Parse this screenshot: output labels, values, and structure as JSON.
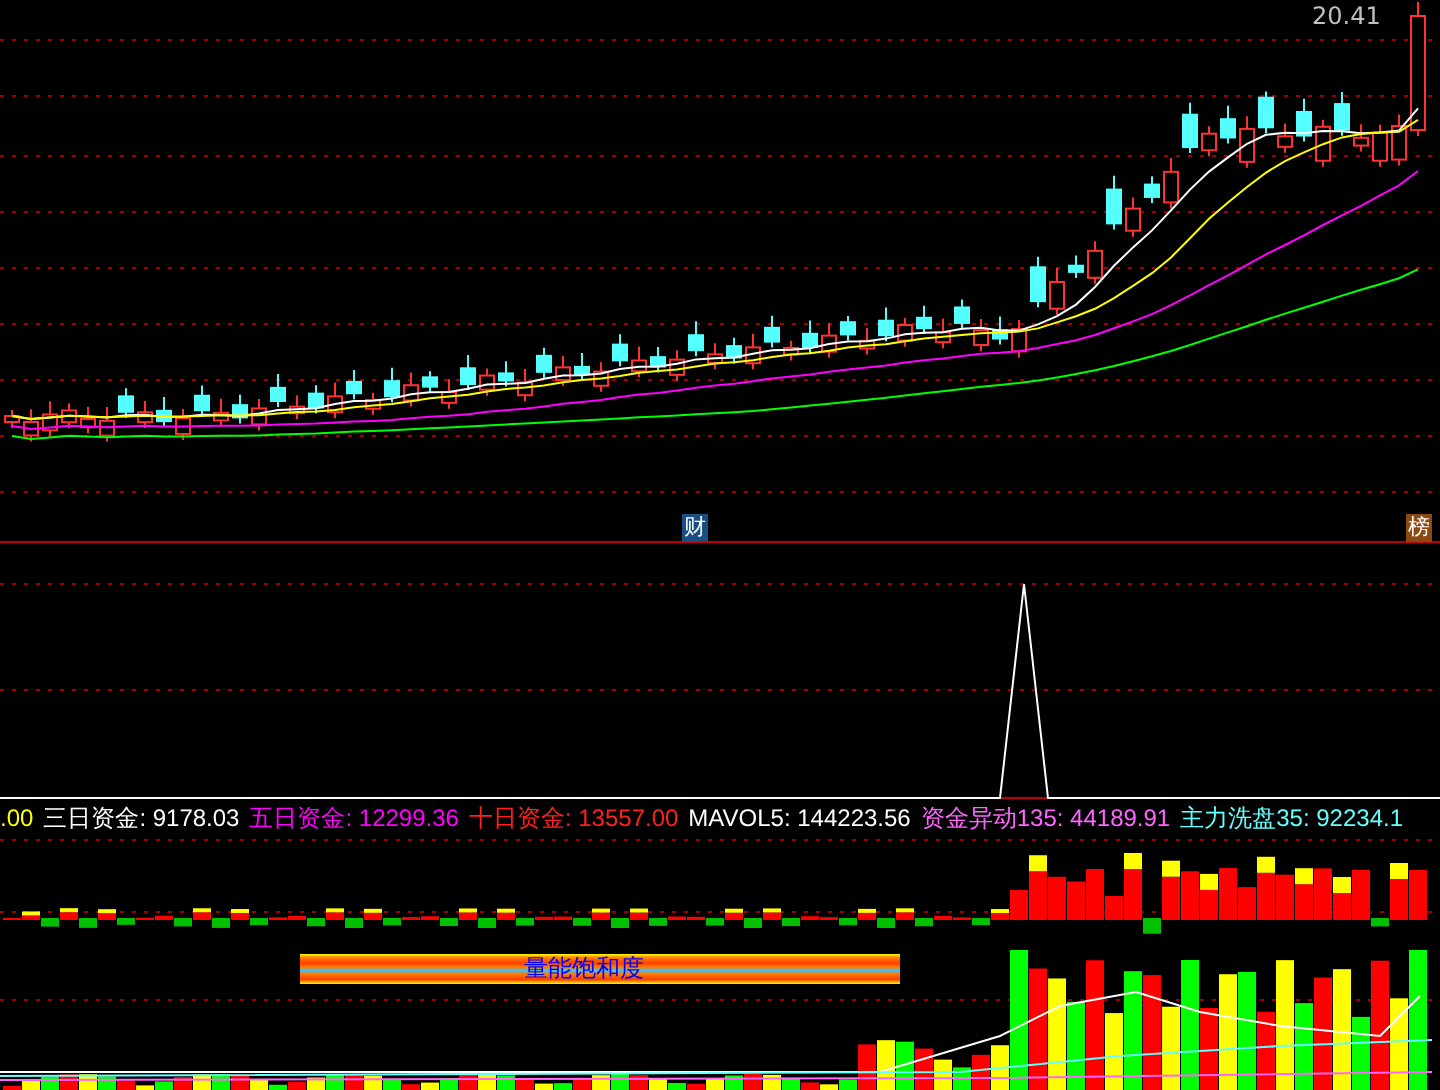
{
  "main_chart": {
    "high_label": "20.41",
    "markers": [
      {
        "text": "财",
        "kind": "finance"
      },
      {
        "text": "榜",
        "kind": "ranking"
      }
    ]
  },
  "indicator_legend": [
    {
      "text": ".00",
      "color": "#ffff00"
    },
    {
      "text": "三日资金: 9178.03",
      "color": "#ffffff"
    },
    {
      "text": "五日资金: 12299.36",
      "color": "#ff00ff"
    },
    {
      "text": "十日资金: 13557.00",
      "color": "#ff2020"
    },
    {
      "text": "MAVOL5: 144223.56",
      "color": "#ffffff"
    },
    {
      "text": "资金异动135: 44189.91",
      "color": "#ff66ff"
    },
    {
      "text": "主力洗盘35: 92234.1",
      "color": "#66ffff"
    }
  ],
  "volume_panel": {
    "banner": "量能饱和度"
  }
}
